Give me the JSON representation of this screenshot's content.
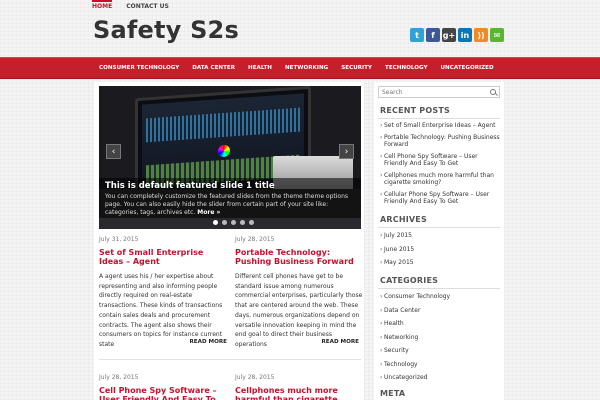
{
  "topnav": [
    {
      "label": "HOME",
      "active": true
    },
    {
      "label": "CONTACT US",
      "active": false
    }
  ],
  "site": {
    "title": "Safety S2s"
  },
  "social": [
    {
      "icon": "twitter-icon",
      "glyph": "t",
      "color": "#2fa3d6"
    },
    {
      "icon": "facebook-icon",
      "glyph": "f",
      "color": "#3b5998"
    },
    {
      "icon": "google-plus-icon",
      "glyph": "g+",
      "color": "#444444"
    },
    {
      "icon": "linkedin-icon",
      "glyph": "in",
      "color": "#0a76b4"
    },
    {
      "icon": "rss-icon",
      "glyph": "))",
      "color": "#f08a24"
    },
    {
      "icon": "email-icon",
      "glyph": "✉",
      "color": "#5bb535"
    }
  ],
  "mainnav": [
    "CONSUMER TECHNOLOGY",
    "DATA CENTER",
    "HEALTH",
    "NETWORKING",
    "SECURITY",
    "TECHNOLOGY",
    "UNCATEGORIZED"
  ],
  "slider": {
    "title": "This is default featured slide 1 title",
    "text": "You can completely customize the featured slides from the theme theme options page. You can also easily hide the slider from certain part of your site like: categories, tags, archives etc.",
    "more": "More »",
    "slides": 5,
    "active": 0
  },
  "posts": [
    {
      "date": "July 31, 2015",
      "title": "Set of Small Enterprise Ideas – Agent",
      "excerpt": "A agent uses his / her expertise about representing and also informing people directly required on real-estate transactions. These kinds of transactions contain sales deals and procurement contracts. The agent also shows their consumers on topics for instance current state",
      "readmore": "READ MORE"
    },
    {
      "date": "July 28, 2015",
      "title": "Portable Technology: Pushing Business Forward",
      "excerpt": "Different cell phones have get to be standard issue among numerous commercial enterprises, particularly those that are centered around the web. These days, numerous organizations depend on versatile innovation keeping in mind the end goal to direct their business operations",
      "readmore": "READ MORE"
    },
    {
      "date": "July 28, 2015",
      "title": "Cell Phone Spy Software – User Friendly And Easy To Get"
    },
    {
      "date": "July 28, 2015",
      "title": "Cellphones much more harmful than cigarette smoking?"
    }
  ],
  "sidebar": {
    "search_placeholder": "Search",
    "recent_posts_title": "RECENT POSTS",
    "recent_posts": [
      "Set of Small Enterprise Ideas – Agent",
      "Portable Technology: Pushing Business Forward",
      "Cell Phone Spy Software – User Friendly And Easy To Get",
      "Cellphones much more harmful than cigarette smoking?",
      "Cellular Phone Spy Software – User Friendly And Easy To Get"
    ],
    "archives_title": "ARCHIVES",
    "archives": [
      "July 2015",
      "June 2015",
      "May 2015"
    ],
    "categories_title": "CATEGORIES",
    "categories": [
      "Consumer Technology",
      "Data Center",
      "Health",
      "Networking",
      "Security",
      "Technology",
      "Uncategorized"
    ],
    "meta_title": "META"
  }
}
